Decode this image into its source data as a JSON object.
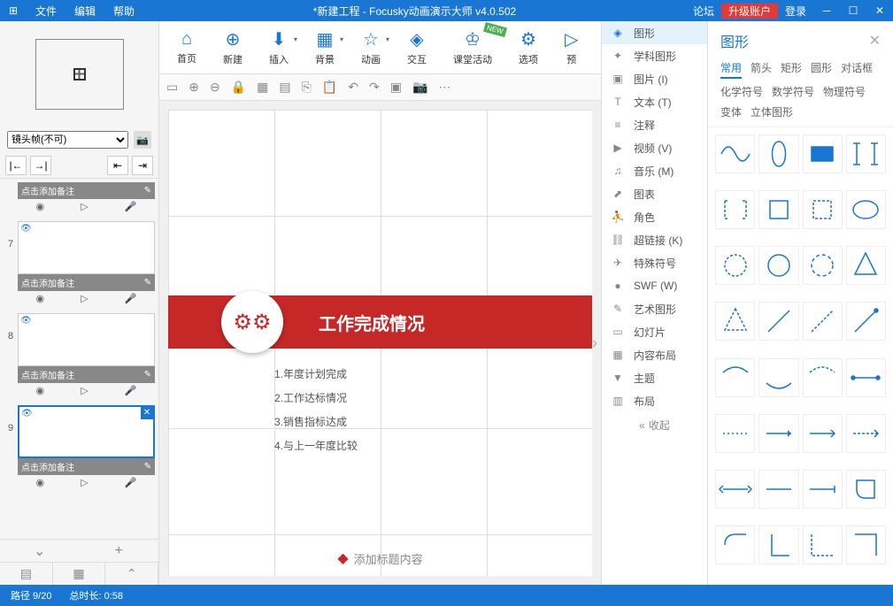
{
  "titlebar": {
    "menus": [
      "文件",
      "编辑",
      "帮助"
    ],
    "title": "*新建工程 - Focusky动画演示大师  v4.0.502",
    "forum": "论坛",
    "upgrade": "升级账户",
    "login": "登录"
  },
  "toolbar": {
    "home": "首页",
    "new": "新建",
    "insert": "插入",
    "background": "背景",
    "animation": "动画",
    "interaction": "交互",
    "classroom": "课堂活动",
    "options": "选项",
    "preview": "预",
    "new_badge": "NEW"
  },
  "framedropdown": "镜头帧(不可)",
  "slides": {
    "caption": "点击添加备注",
    "numbers": [
      "7",
      "8",
      "9"
    ]
  },
  "canvas": {
    "main_title": "工作完成情况",
    "bullets": [
      "1.年度计划完成",
      "2.工作达标情况",
      "3.销售指标达成",
      "4.与上一年度比较"
    ],
    "subtitle": "添加标题内容"
  },
  "insert_menu": {
    "items": [
      {
        "icon": "◈",
        "label": "图形",
        "blue": true,
        "active": true
      },
      {
        "icon": "✦",
        "label": "学科图形"
      },
      {
        "icon": "▣",
        "label": "图片 (I)"
      },
      {
        "icon": "T",
        "label": "文本 (T)"
      },
      {
        "icon": "≡",
        "label": "注释"
      },
      {
        "icon": "▶",
        "label": "视频 (V)"
      },
      {
        "icon": "♫",
        "label": "音乐 (M)"
      },
      {
        "icon": "⬈",
        "label": "图表"
      },
      {
        "icon": "⛹",
        "label": "角色"
      },
      {
        "icon": "⛓",
        "label": "超链接 (K)"
      },
      {
        "icon": "✈",
        "label": "特殊符号"
      },
      {
        "icon": "●",
        "label": "SWF (W)"
      },
      {
        "icon": "✎",
        "label": "艺术图形"
      },
      {
        "icon": "▭",
        "label": "幻灯片"
      },
      {
        "icon": "▦",
        "label": "内容布局"
      },
      {
        "icon": "▼",
        "label": "主题"
      },
      {
        "icon": "▥",
        "label": "布局"
      }
    ],
    "collapse": "收起"
  },
  "shapes_panel": {
    "title": "图形",
    "tabs": [
      "常用",
      "箭头",
      "矩形",
      "圆形",
      "对话框",
      "化学符号",
      "数学符号",
      "物理符号",
      "变体",
      "立体图形"
    ],
    "active_tab": "常用"
  },
  "statusbar": {
    "path": "路径 9/20",
    "duration": "总时长: 0:58"
  }
}
